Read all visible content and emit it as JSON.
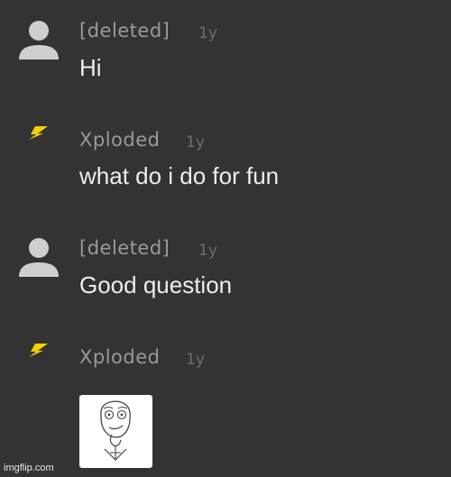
{
  "comments": [
    {
      "username": "[deleted]",
      "time": "1y",
      "text": "Hi",
      "avatar": "default-user-icon"
    },
    {
      "username": "Xploded",
      "time": "1y",
      "text": "what do i do for fun",
      "avatar": "lightning-bolt-icon"
    },
    {
      "username": "[deleted]",
      "time": "1y",
      "text": "Good question",
      "avatar": "default-user-icon"
    },
    {
      "username": "Xploded",
      "time": "1y",
      "image": "challenge-accepted-meme",
      "avatar": "lightning-bolt-icon"
    }
  ],
  "watermark": "imgflip.com",
  "colors": {
    "background": "#333333",
    "username": "#9a9a9a",
    "time": "#6f6f6f",
    "text": "#ededed",
    "bolt": "#f2d100",
    "avatar": "#cfcfcf"
  }
}
